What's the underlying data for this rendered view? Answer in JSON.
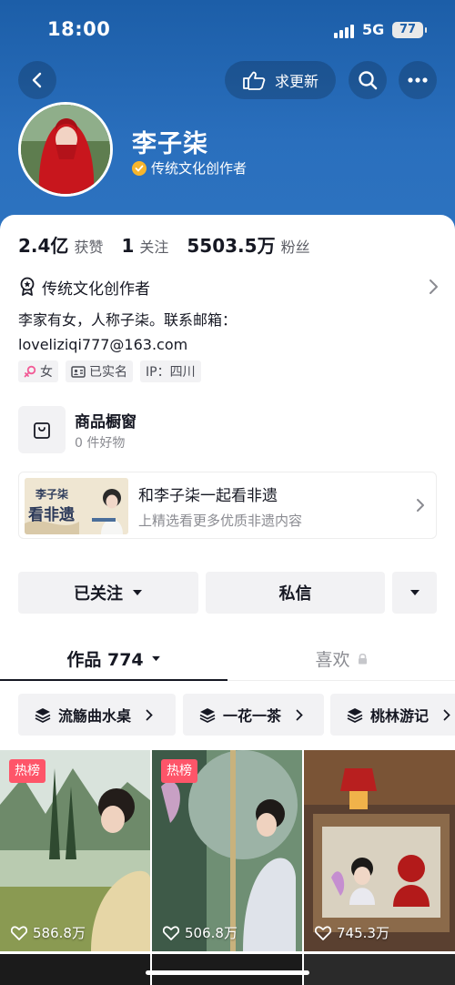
{
  "status_bar": {
    "time": "18:00",
    "network": "5G",
    "battery": "77"
  },
  "header": {
    "update_label": "求更新"
  },
  "profile": {
    "name": "李子柒",
    "creator_label": "传统文化创作者"
  },
  "stats": [
    {
      "value": "2.4亿",
      "label": "获赞"
    },
    {
      "value": "1",
      "label": "关注"
    },
    {
      "value": "5503.5万",
      "label": "粉丝"
    }
  ],
  "tag_row": {
    "label": "传统文化创作者"
  },
  "bio": {
    "line1": "李家有女，人称子柒。联系邮箱：",
    "line2": "loveliziqi777@163.com"
  },
  "chips": {
    "gender": "女",
    "verified": "已实名",
    "ip": "IP：四川"
  },
  "shop": {
    "title": "商品橱窗",
    "subtitle": "0 件好物"
  },
  "promo": {
    "title": "和李子柒一起看非遗",
    "subtitle": "上精选看更多优质非遗内容",
    "thumb_top": "李子柒",
    "thumb_bottom": "看非遗"
  },
  "actions": {
    "follow": "已关注",
    "message": "私信"
  },
  "tabs": {
    "works": "作品 774",
    "likes": "喜欢"
  },
  "collections": [
    {
      "label": "流觞曲水桌"
    },
    {
      "label": "一花一茶"
    },
    {
      "label": "桃林游记"
    }
  ],
  "videos": [
    {
      "badge": "热榜",
      "likes": "586.8万"
    },
    {
      "badge": "热榜",
      "likes": "506.8万"
    },
    {
      "badge": "",
      "likes": "745.3万"
    }
  ],
  "colors": {
    "header_blue": "#2a6fbd",
    "hot_badge": "#fe5569",
    "verify_gold": "#f7b52c",
    "female_pink": "#f25c97"
  }
}
